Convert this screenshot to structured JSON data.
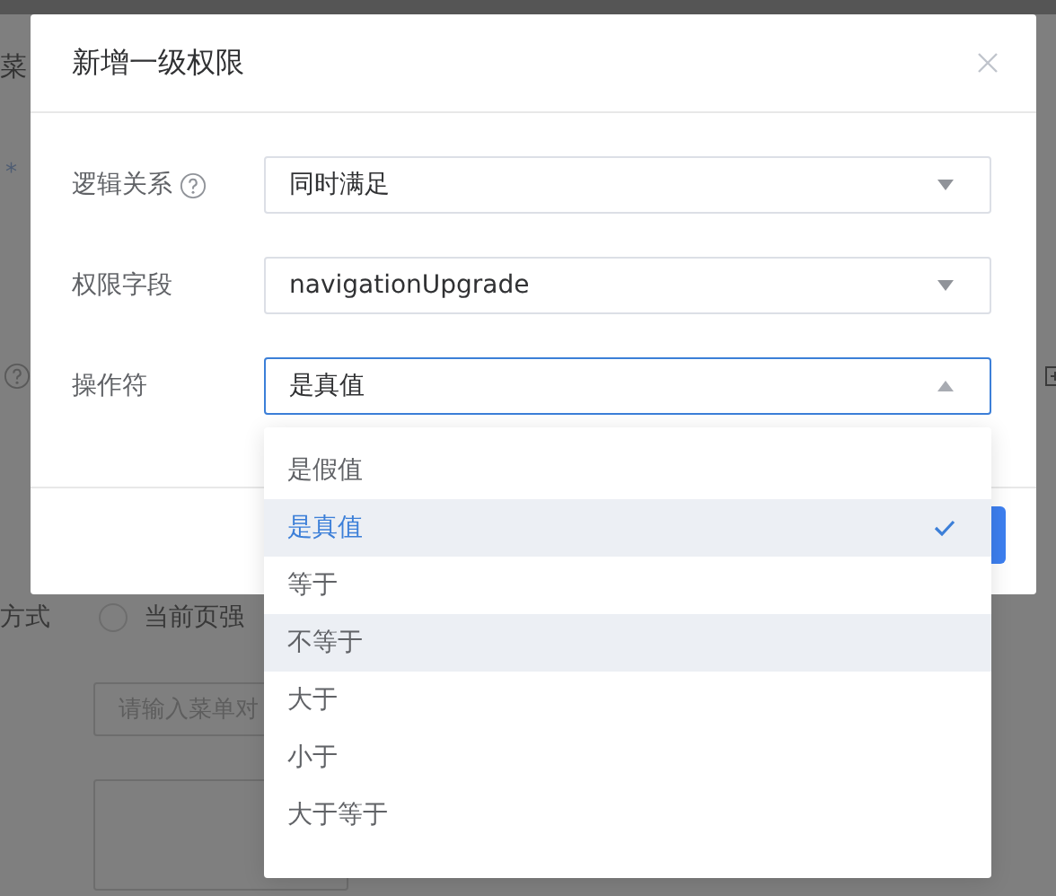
{
  "background_page": {
    "section_title": "菜",
    "required_mark": "*",
    "display_mode_label": "方式",
    "radio_option": {
      "label": "当前页强",
      "selected": false
    },
    "menu_input": {
      "placeholder": "请输入菜单对"
    }
  },
  "dialog": {
    "title": "新增一级权限",
    "fields": [
      {
        "label": "逻辑关系",
        "help": true,
        "value": "同时满足",
        "open": false
      },
      {
        "label": "权限字段",
        "help": false,
        "value": "navigationUpgrade",
        "open": false
      },
      {
        "label": "操作符",
        "help": false,
        "value": "是真值",
        "open": true
      }
    ],
    "dropdown": {
      "options": [
        {
          "label": "是假值",
          "selected": false,
          "hovered": false
        },
        {
          "label": "是真值",
          "selected": true,
          "hovered": true
        },
        {
          "label": "等于",
          "selected": false,
          "hovered": false
        },
        {
          "label": "不等于",
          "selected": false,
          "hovered": true
        },
        {
          "label": "大于",
          "selected": false,
          "hovered": false
        },
        {
          "label": "小于",
          "selected": false,
          "hovered": false
        },
        {
          "label": "大于等于",
          "selected": false,
          "hovered": false
        }
      ]
    }
  }
}
